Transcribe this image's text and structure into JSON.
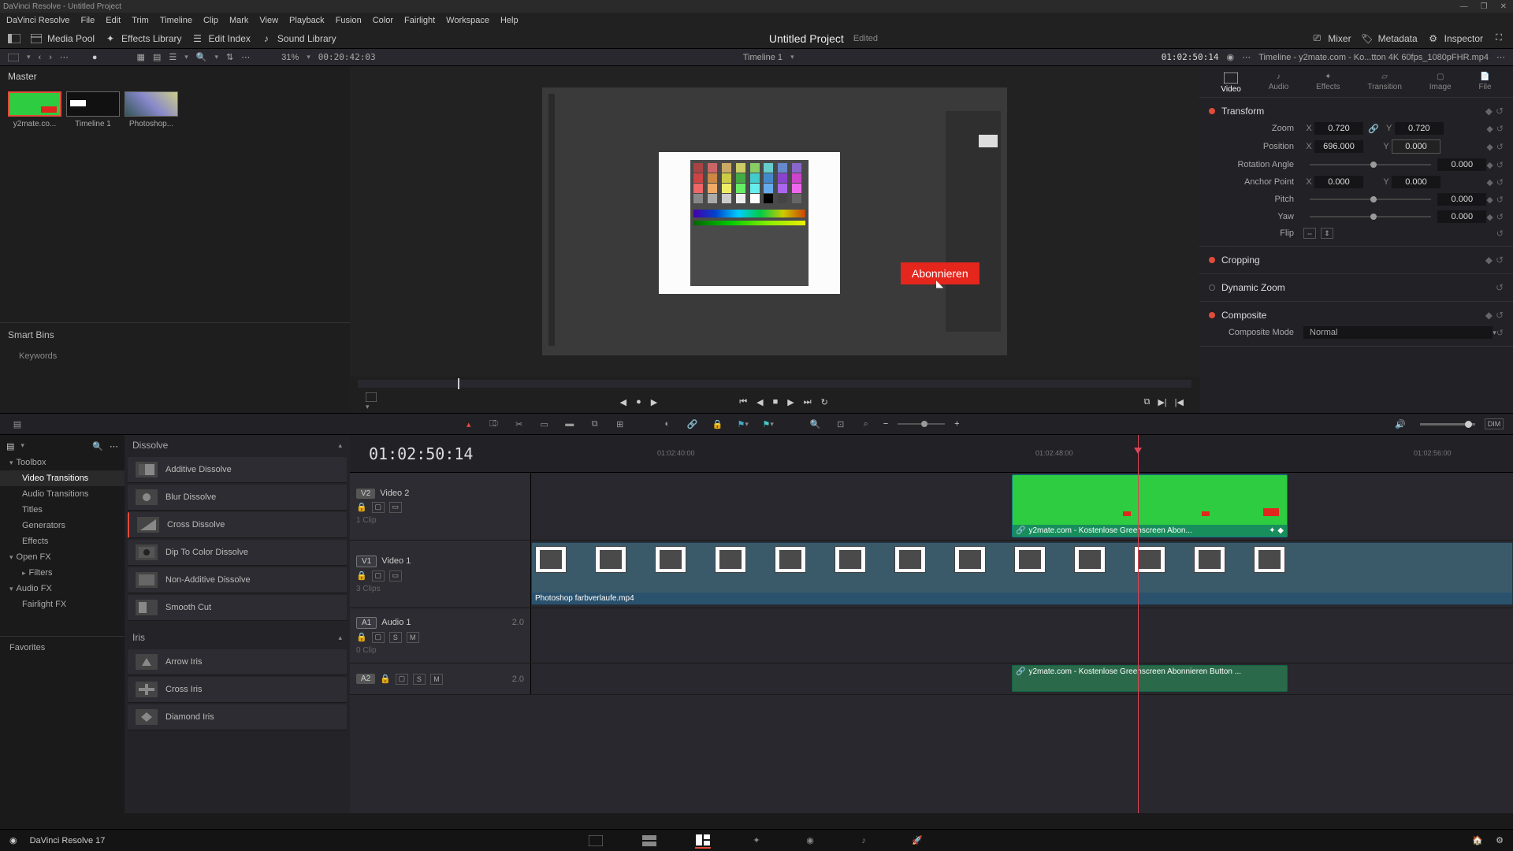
{
  "app": {
    "title": "DaVinci Resolve - Untitled Project",
    "version": "DaVinci Resolve 17"
  },
  "menu": [
    "DaVinci Resolve",
    "File",
    "Edit",
    "Trim",
    "Timeline",
    "Clip",
    "Mark",
    "View",
    "Playback",
    "Fusion",
    "Color",
    "Fairlight",
    "Workspace",
    "Help"
  ],
  "topbar": {
    "media_pool": "Media Pool",
    "effects_library": "Effects Library",
    "edit_index": "Edit Index",
    "sound_library": "Sound Library",
    "project_title": "Untitled Project",
    "project_status": "Edited",
    "mixer": "Mixer",
    "metadata": "Metadata",
    "inspector": "Inspector"
  },
  "subbar": {
    "zoom_pct": "31%",
    "tc_left": "00:20:42:03",
    "timeline_name": "Timeline 1",
    "tc_right": "01:02:50:14",
    "clip_name": "Timeline - y2mate.com - Ko...tton 4K 60fps_1080pFHR.mp4"
  },
  "media": {
    "master": "Master",
    "thumbs": [
      {
        "label": "y2mate.co..."
      },
      {
        "label": "Timeline 1"
      },
      {
        "label": "Photoshop..."
      }
    ],
    "smart_bins": "Smart Bins",
    "keywords": "Keywords"
  },
  "viewer": {
    "subscribe": "Abonnieren"
  },
  "inspector": {
    "tabs": [
      "Video",
      "Audio",
      "Effects",
      "Transition",
      "Image",
      "File"
    ],
    "transform": "Transform",
    "zoom": "Zoom",
    "zoom_x": "0.720",
    "zoom_y": "0.720",
    "position": "Position",
    "pos_x": "696.000",
    "pos_y": "0.000",
    "rotation": "Rotation Angle",
    "rot_v": "0.000",
    "anchor": "Anchor Point",
    "anch_x": "0.000",
    "anch_y": "0.000",
    "pitch": "Pitch",
    "pitch_v": "0.000",
    "yaw": "Yaw",
    "yaw_v": "0.000",
    "flip": "Flip",
    "cropping": "Cropping",
    "dynamic_zoom": "Dynamic Zoom",
    "composite": "Composite",
    "composite_mode": "Composite Mode",
    "composite_val": "Normal"
  },
  "fx": {
    "toolbox": "Toolbox",
    "video_trans": "Video Transitions",
    "audio_trans": "Audio Transitions",
    "titles": "Titles",
    "generators": "Generators",
    "effects": "Effects",
    "open_fx": "Open FX",
    "filters": "Filters",
    "audio_fx": "Audio FX",
    "fairlight_fx": "Fairlight FX",
    "favorites": "Favorites",
    "dissolve": "Dissolve",
    "items_dissolve": [
      "Additive Dissolve",
      "Blur Dissolve",
      "Cross Dissolve",
      "Dip To Color Dissolve",
      "Non-Additive Dissolve",
      "Smooth Cut"
    ],
    "iris": "Iris",
    "items_iris": [
      "Arrow Iris",
      "Cross Iris",
      "Diamond Iris"
    ]
  },
  "timeline": {
    "tc": "01:02:50:14",
    "ruler": [
      "01:02:40:00",
      "01:02:48:00",
      "01:02:56:00"
    ],
    "v2": "V2",
    "video2": "Video 2",
    "v1": "V1",
    "video1": "Video 1",
    "v1_clips": "1 Clip",
    "v1_3clips": "3 Clips",
    "a1": "A1",
    "audio1": "Audio 1",
    "a1_clips": "0 Clip",
    "a1_lvl": "2.0",
    "a2": "A2",
    "a2_lvl": "2.0",
    "clip_green": "y2mate.com - Kostenlose Greenscreen Abon...",
    "clip_ps": "Photoshop farbverlaufe.mp4",
    "clip_green2": "y2mate.com - Kostenlose Greenscreen Abonnieren Button ..."
  }
}
